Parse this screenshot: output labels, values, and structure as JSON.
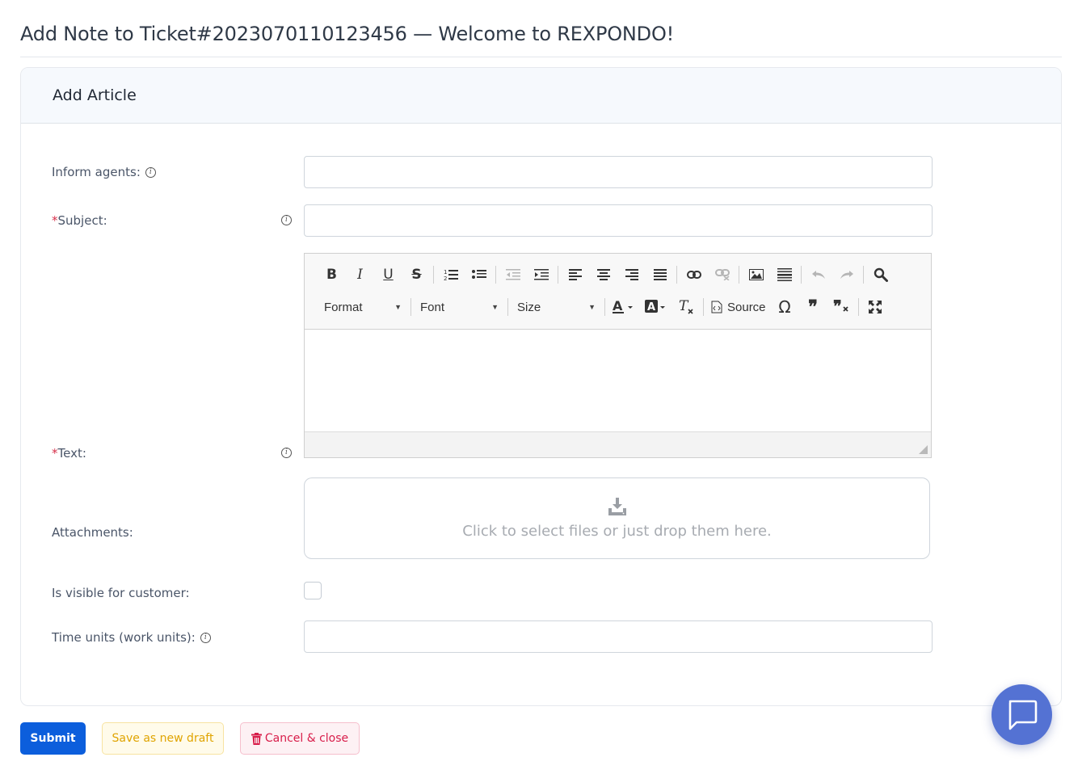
{
  "page": {
    "title": "Add Note to Ticket#2023070110123456 — Welcome to REXPONDO!"
  },
  "card": {
    "header": "Add Article"
  },
  "form": {
    "inform_agents": {
      "label": "Inform agents:",
      "value": ""
    },
    "subject": {
      "required_mark": "*",
      "label": "Subject:",
      "value": ""
    },
    "text": {
      "required_mark": "*",
      "label": "Text:"
    },
    "attachments": {
      "label": "Attachments:",
      "dropzone_text": "Click to select files or just drop them here."
    },
    "visible_for_customer": {
      "label": "Is visible for customer:",
      "checked": false
    },
    "time_units": {
      "label": "Time units (work units):",
      "value": ""
    }
  },
  "editor": {
    "format_label": "Format",
    "font_label": "Font",
    "size_label": "Size",
    "source_label": "Source",
    "row1_icons": [
      "bold-icon",
      "italic-icon",
      "underline-icon",
      "strikethrough-icon",
      "numbered-list-icon",
      "bulleted-list-icon",
      "outdent-icon",
      "indent-icon",
      "align-left-icon",
      "align-center-icon",
      "align-right-icon",
      "justify-icon",
      "link-icon",
      "unlink-icon",
      "image-icon",
      "horizontal-rule-icon",
      "undo-icon",
      "redo-icon",
      "find-icon"
    ],
    "row2_icons": [
      "text-color-icon",
      "background-color-icon",
      "remove-format-icon",
      "source-icon",
      "special-char-icon",
      "blockquote-icon",
      "remove-blockquote-icon",
      "maximize-icon"
    ]
  },
  "buttons": {
    "submit": "Submit",
    "save_draft": "Save as new draft",
    "cancel": "Cancel & close"
  },
  "colors": {
    "primary": "#0c5edc",
    "warning": "#e0a400",
    "danger": "#d81d4a",
    "chat": "#5472d3",
    "required": "#d6304a"
  }
}
